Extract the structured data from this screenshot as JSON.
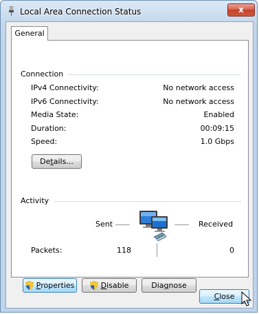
{
  "window": {
    "title": "Local Area Connection Status",
    "close_glyph": "x"
  },
  "tabs": [
    {
      "label": "General",
      "selected": true
    }
  ],
  "connection": {
    "group_title": "Connection",
    "rows": [
      {
        "label": "IPv4 Connectivity:",
        "value": "No network access"
      },
      {
        "label": "IPv6 Connectivity:",
        "value": "No network access"
      },
      {
        "label": "Media State:",
        "value": "Enabled"
      },
      {
        "label": "Duration:",
        "value": "00:09:15"
      },
      {
        "label": "Speed:",
        "value": "1.0 Gbps"
      }
    ],
    "details_button": {
      "pre": "De",
      "accel": "t",
      "post": "ails..."
    }
  },
  "activity": {
    "group_title": "Activity",
    "sent_label": "Sent",
    "received_label": "Received",
    "packets_label": "Packets:",
    "packets_sent": "118",
    "packets_received": "0",
    "icon": "network-computers-icon"
  },
  "buttons": {
    "properties": {
      "pre": "",
      "accel": "P",
      "post": "roperties",
      "icon": "uac-shield-icon"
    },
    "disable": {
      "pre": "",
      "accel": "D",
      "post": "isable",
      "icon": "uac-shield-icon"
    },
    "diagnose": {
      "pre": "Dia",
      "accel": "g",
      "post": "nose"
    },
    "close": {
      "pre": "",
      "accel": "C",
      "post": "lose"
    }
  },
  "colors": {
    "title_gradient_top": "#dbe8f5",
    "close_button_red": "#c2402a",
    "focus_blue": "#3c7fb1"
  }
}
